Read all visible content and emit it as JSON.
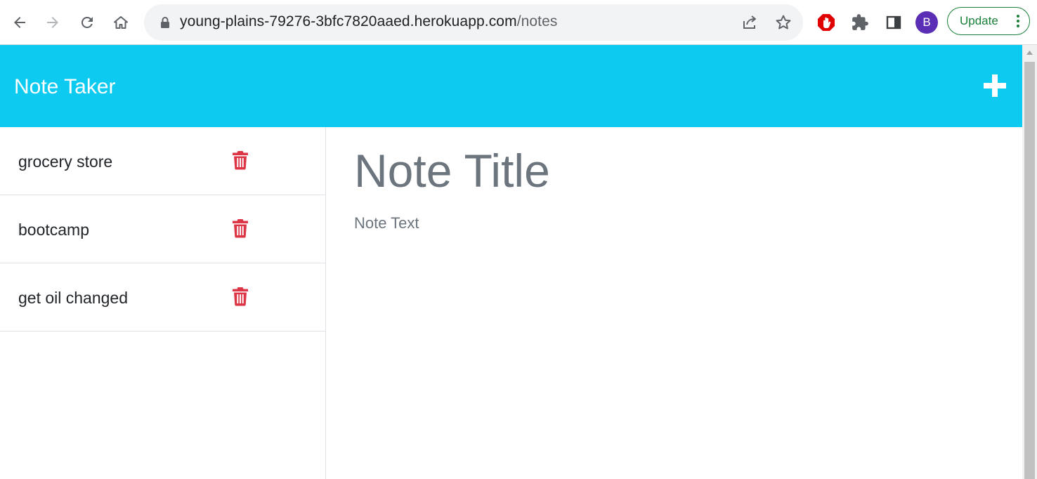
{
  "browser": {
    "url_host": "young-plains-79276-3bfc7820aaed.herokuapp.com",
    "url_path": "/notes",
    "profile_initial": "B",
    "update_label": "Update"
  },
  "app": {
    "brand": "Note Taker",
    "notes": [
      {
        "title": "grocery store"
      },
      {
        "title": "bootcamp"
      },
      {
        "title": "get oil changed"
      }
    ],
    "editor": {
      "title_placeholder": "Note Title",
      "text_placeholder": "Note Text"
    }
  },
  "colors": {
    "header": "#0dcaf0",
    "trash": "#dc3545",
    "placeholder": "#6c757d"
  },
  "icons": [
    "back-icon",
    "forward-icon",
    "reload-icon",
    "home-icon",
    "lock-icon",
    "share-icon",
    "star-icon",
    "adblock-icon",
    "extensions-icon",
    "side-panel-icon",
    "more-icon",
    "plus-icon",
    "trash-icon"
  ]
}
